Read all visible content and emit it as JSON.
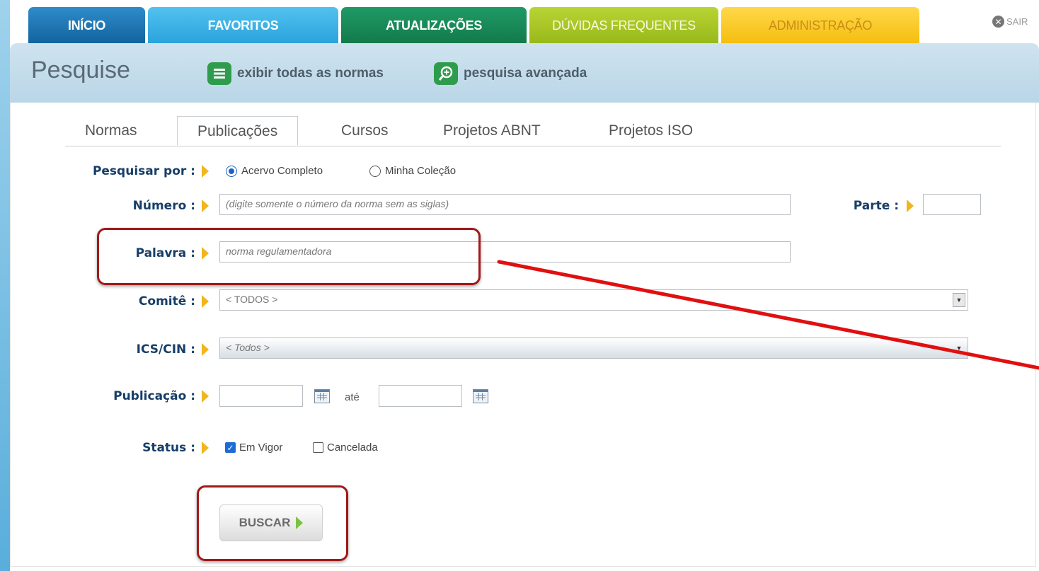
{
  "nav": {
    "tabs": [
      {
        "label": "INÍCIO"
      },
      {
        "label": "FAVORITOS"
      },
      {
        "label": "ATUALIZAÇÕES"
      },
      {
        "label": "DÚVIDAS FREQUENTES"
      },
      {
        "label": "ADMINISTRAÇÃO"
      }
    ],
    "logout_label": "SAIR"
  },
  "header": {
    "title": "Pesquise",
    "show_all_label": "exibir todas as normas",
    "advanced_label": "pesquisa avançada"
  },
  "subtabs": [
    "Normas",
    "Publicações",
    "Cursos",
    "Projetos ABNT",
    "Projetos ISO"
  ],
  "active_subtab": "Publicações",
  "form": {
    "search_by": {
      "label": "Pesquisar por :",
      "options": [
        "Acervo Completo",
        "Minha Coleção"
      ],
      "selected": "Acervo Completo"
    },
    "numero": {
      "label": "Número :",
      "placeholder": "(digite somente o número da norma sem as siglas)",
      "value": ""
    },
    "parte": {
      "label": "Parte :",
      "value": ""
    },
    "palavra": {
      "label": "Palavra :",
      "value": "norma regulamentadora"
    },
    "comite": {
      "label": "Comitê :",
      "selected": "< TODOS >"
    },
    "ics": {
      "label": "ICS/CIN :",
      "selected": "< Todos >"
    },
    "publicacao": {
      "label": "Publicação :",
      "from": "",
      "to_label": "até",
      "to": ""
    },
    "status": {
      "label": "Status :",
      "options": [
        {
          "label": "Em Vigor",
          "checked": true
        },
        {
          "label": "Cancelada",
          "checked": false
        }
      ]
    },
    "submit_label": "BUSCAR"
  },
  "colors": {
    "tab_inicio": "#1a6fab",
    "tab_favoritos": "#3fb3e6",
    "tab_atualizacoes": "#188a58",
    "tab_duvidas": "#a8c626",
    "tab_admin": "#f8c92a",
    "label_text": "#173e68",
    "arrow": "#f2b51d",
    "annotation_red": "#e01010"
  }
}
